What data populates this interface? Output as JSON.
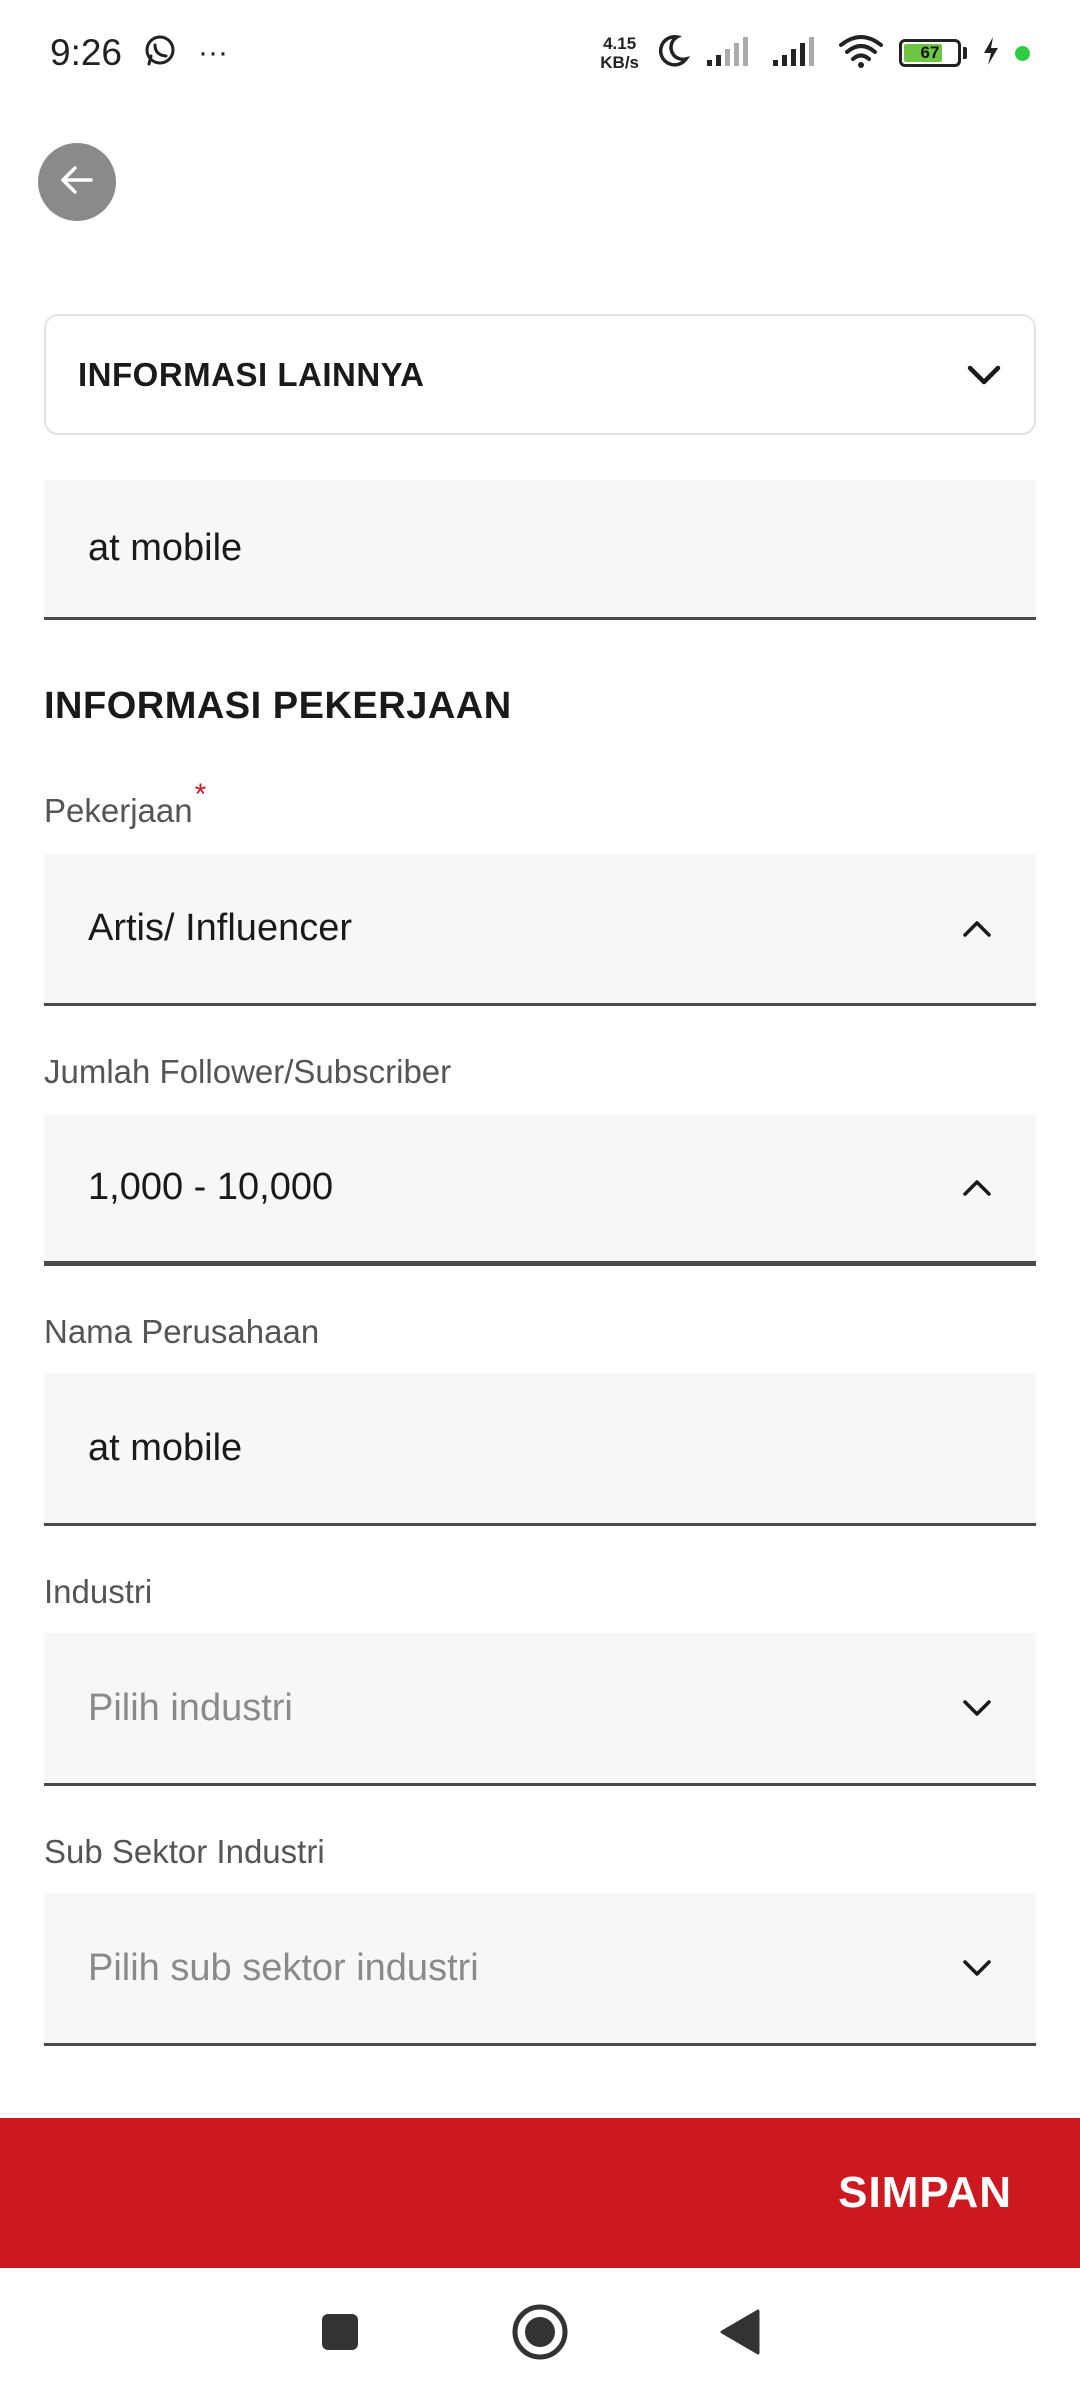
{
  "status_bar": {
    "time": "9:26",
    "more": "···",
    "speed_value": "4.15",
    "speed_unit": "KB/s",
    "battery": "67"
  },
  "accordion": {
    "label": "INFORMASI LAINNYA"
  },
  "top_field": {
    "value": "at mobile"
  },
  "section": {
    "title": "INFORMASI PEKERJAAN"
  },
  "pekerjaan": {
    "label": "Pekerjaan",
    "required_mark": "*",
    "value": "Artis/ Influencer"
  },
  "followers": {
    "label": "Jumlah Follower/Subscriber",
    "value": "1,000 - 10,000"
  },
  "company": {
    "label": "Nama Perusahaan",
    "value": "at mobile"
  },
  "industry": {
    "label": "Industri",
    "placeholder": "Pilih industri"
  },
  "sub_sector": {
    "label": "Sub Sektor Industri",
    "placeholder": "Pilih sub sektor industri"
  },
  "save_button": {
    "label": "SIMPAN"
  },
  "colors": {
    "primary_red": "#ce1820",
    "field_bg": "#f7f7f7",
    "back_button_bg": "#8a8a8a"
  }
}
